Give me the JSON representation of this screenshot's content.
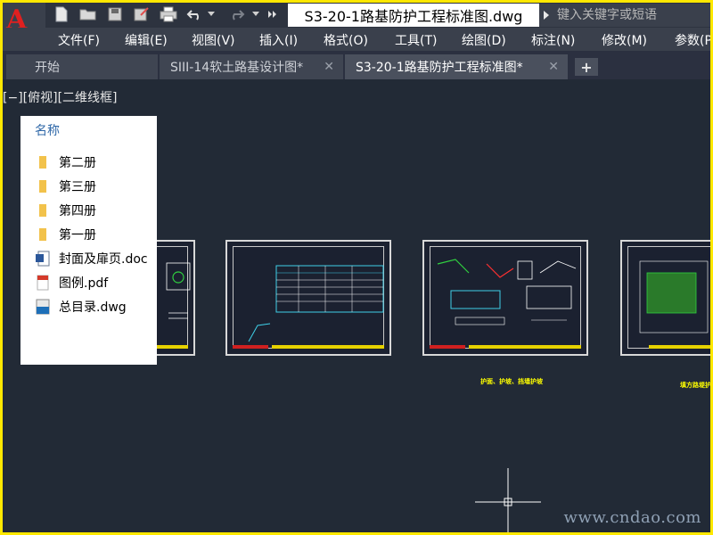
{
  "title_bar": {
    "document_title": "S3-20-1路基防护工程标准图.dwg",
    "search_placeholder": "键入关键字或短语"
  },
  "menu": {
    "items": [
      {
        "label": "文件(F)"
      },
      {
        "label": "编辑(E)"
      },
      {
        "label": "视图(V)"
      },
      {
        "label": "插入(I)"
      },
      {
        "label": "格式(O)"
      },
      {
        "label": "工具(T)"
      },
      {
        "label": "绘图(D)"
      },
      {
        "label": "标注(N)"
      },
      {
        "label": "修改(M)"
      },
      {
        "label": "参数(P)"
      }
    ]
  },
  "tabs": {
    "items": [
      {
        "label": "开始"
      },
      {
        "label": "SIII-14软土路基设计图*"
      },
      {
        "label": "S3-20-1路基防护工程标准图*"
      }
    ]
  },
  "viewport": {
    "label": "[−][俯视][二维线框]",
    "captions": [
      "护面、护坡、挡墙护坡",
      "填方路堤护"
    ]
  },
  "file_popup": {
    "header": "名称",
    "items": [
      {
        "name": "第二册",
        "type": "folder"
      },
      {
        "name": "第三册",
        "type": "folder"
      },
      {
        "name": "第四册",
        "type": "folder"
      },
      {
        "name": "第一册",
        "type": "folder"
      },
      {
        "name": "封面及扉页.doc",
        "type": "doc"
      },
      {
        "name": "图例.pdf",
        "type": "pdf"
      },
      {
        "name": "总目录.dwg",
        "type": "dwg"
      }
    ]
  },
  "watermark": "www.cndao.com",
  "colors": {
    "border": "#ffe800",
    "background": "#222a36",
    "menubar": "#3a404c",
    "accent_link": "#2f68a8",
    "folder": "#f2c24b"
  }
}
